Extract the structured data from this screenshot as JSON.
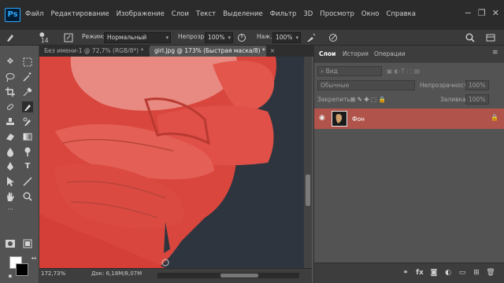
{
  "app": {
    "logo": "Ps"
  },
  "menu": [
    "Файл",
    "Редактирование",
    "Изображение",
    "Слои",
    "Текст",
    "Выделение",
    "Фильтр",
    "3D",
    "Просмотр",
    "Окно",
    "Справка"
  ],
  "window_controls": {
    "minimize": "−",
    "restore": "❐",
    "close": "✕"
  },
  "options": {
    "brush_size": "14",
    "mode_label": "Режим:",
    "mode_value": "Нормальный",
    "opacity_label": "Непрозр.:",
    "opacity_value": "100%",
    "flow_label": "Наж.:",
    "flow_value": "100%"
  },
  "tabs": [
    {
      "label": "Без имени-1 @ 72,7% (RGB/8*) *",
      "close": "×"
    },
    {
      "label": "girl.jpg @ 173% (Быстрая маска/8) *",
      "close": "×"
    }
  ],
  "status": {
    "zoom": "172,73%",
    "doc": "Док: 6,18M/8,07M"
  },
  "panel": {
    "tabs": [
      "Слои",
      "История",
      "Операции"
    ],
    "search_placeholder": "Вид",
    "blend_mode": "Обычные",
    "opacity_label": "Непрозрачность:",
    "opacity_value": "100%",
    "lock_label": "Закрепить:",
    "fill_label": "Заливка:",
    "fill_value": "100%",
    "layer_name": "Фон"
  },
  "colors": {
    "quick_mask": "#e0524a",
    "accent": "#31a8ff",
    "layer_selected": "#b0534a"
  }
}
